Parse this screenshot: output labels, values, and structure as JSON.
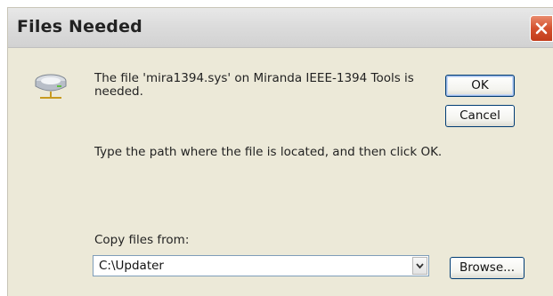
{
  "window": {
    "title": "Files Needed"
  },
  "icons": {
    "drive": "network-drive-icon",
    "close": "close-icon",
    "dropdown": "chevron-down-icon"
  },
  "message": {
    "line1": "The file 'mira1394.sys' on Miranda IEEE-1394 Tools is needed.",
    "line2": "Type the path where the file is located, and then click OK."
  },
  "buttons": {
    "ok": "OK",
    "cancel": "Cancel",
    "browse": "Browse..."
  },
  "copy_from": {
    "label": "Copy files from:",
    "value": "C:\\Updater"
  },
  "colors": {
    "dialog_bg": "#ece9d8",
    "close_button": "#d4512e",
    "button_border": "#003c74"
  }
}
